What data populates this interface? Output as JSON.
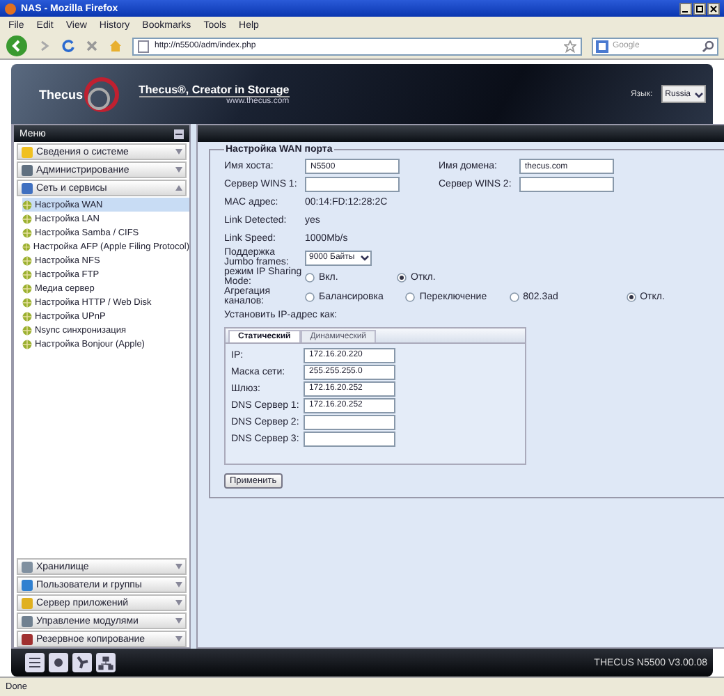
{
  "browser": {
    "title": "NAS - Mozilla Firefox",
    "menu": [
      "File",
      "Edit",
      "View",
      "History",
      "Bookmarks",
      "Tools",
      "Help"
    ],
    "url": "http://n5500/adm/index.php",
    "search_placeholder": "Google",
    "status": "Done"
  },
  "header": {
    "logo": "Thecus",
    "tagline": "Thecus®, Creator in Storage",
    "website": "www.thecus.com",
    "language_label": "Язык:",
    "language": "Russia"
  },
  "menu": {
    "title": "Меню",
    "sections": [
      {
        "label": "Сведения о системе",
        "expanded": false
      },
      {
        "label": "Администрирование",
        "expanded": false
      },
      {
        "label": "Сеть и сервисы",
        "expanded": true,
        "children": [
          {
            "label": "Настройка WAN",
            "selected": true
          },
          {
            "label": "Настройка LAN",
            "selected": false
          },
          {
            "label": "Настройка Samba / CIFS",
            "selected": false
          },
          {
            "label": "Настройка AFP (Apple Filing Protocol)",
            "selected": false
          },
          {
            "label": "Настройка NFS",
            "selected": false
          },
          {
            "label": "Настройка FTP",
            "selected": false
          },
          {
            "label": "Медиа сервер",
            "selected": false
          },
          {
            "label": "Настройка HTTP / Web Disk",
            "selected": false
          },
          {
            "label": "Настройка UPnP",
            "selected": false
          },
          {
            "label": "Nsync синхронизация",
            "selected": false
          },
          {
            "label": "Настройка Bonjour (Apple)",
            "selected": false
          }
        ]
      },
      {
        "label": "Хранилище",
        "expanded": false
      },
      {
        "label": "Пользователи и группы",
        "expanded": false
      },
      {
        "label": "Сервер приложений",
        "expanded": false
      },
      {
        "label": "Управление модулями",
        "expanded": false
      },
      {
        "label": "Резервное копирование",
        "expanded": false
      }
    ]
  },
  "form": {
    "legend": "Настройка WAN порта",
    "rows": [
      {
        "kind": "inputs",
        "items": [
          {
            "label": "Имя хоста:",
            "value": "N5500"
          },
          {
            "label": "Имя домена:",
            "value": "thecus.com"
          }
        ]
      },
      {
        "kind": "inputs",
        "items": [
          {
            "label": "Сервер WINS 1:"
          },
          {
            "label": "Сервер WINS 2:"
          }
        ]
      },
      {
        "kind": "info",
        "label": "MAC адрес:",
        "value": "00:14:FD:12:28:2C"
      },
      {
        "kind": "info",
        "label": "Link Detected:",
        "value": "yes"
      },
      {
        "kind": "info",
        "label": "Link Speed:",
        "value": "1000Mb/s"
      },
      {
        "kind": "select",
        "label": "Поддержка Jumbo frames:",
        "value": "9000 Байты"
      },
      {
        "kind": "radio",
        "label": "режим IP Sharing Mode:",
        "options": [
          {
            "label": "Вкл.",
            "selected": false
          },
          {
            "label": "Откл.",
            "selected": true
          }
        ]
      },
      {
        "kind": "radio",
        "label": "Агрегация каналов:",
        "options": [
          {
            "label": "Балансировка",
            "selected": false
          },
          {
            "label": "Переключение",
            "selected": false
          },
          {
            "label": "802.3ad",
            "selected": false
          },
          {
            "label": "Откл.",
            "selected": true
          }
        ]
      },
      {
        "kind": "heading",
        "label": "Установить IP-адрес как:"
      }
    ],
    "ip_tabs": [
      {
        "label": "Статический",
        "selected": true
      },
      {
        "label": "Динамический",
        "selected": false
      }
    ],
    "ip_fields": [
      {
        "label": "IP:",
        "value": "172.16.20.220"
      },
      {
        "label": "Маска сети:",
        "value": "255.255.255.0"
      },
      {
        "label": "Шлюз:",
        "value": "172.16.20.252"
      },
      {
        "label": "DNS Сервер 1:",
        "value": "172.16.20.252"
      },
      {
        "label": "DNS Сервер 2:"
      },
      {
        "label": "DNS Сервер 3:"
      }
    ],
    "apply_button": "Применить"
  },
  "footer": {
    "version": "THECUS N5500 V3.00.08"
  }
}
